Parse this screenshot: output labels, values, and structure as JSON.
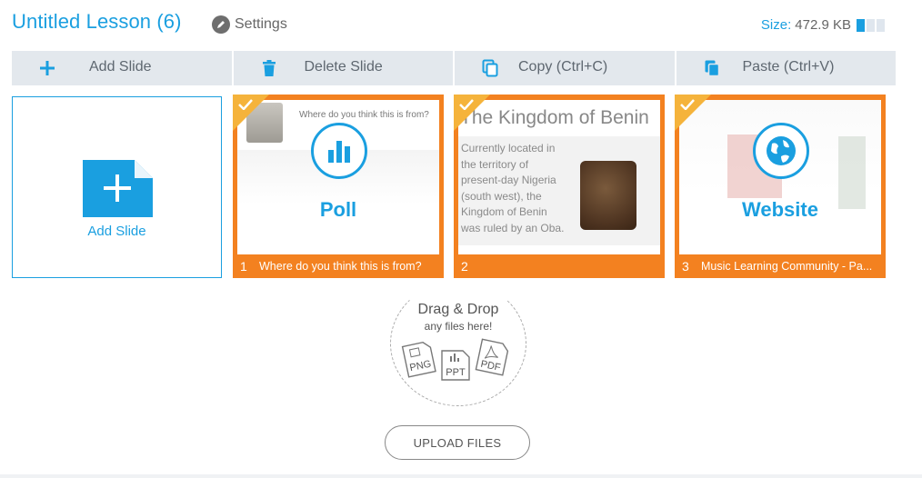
{
  "header": {
    "title": "Untitled Lesson (6)",
    "settings_label": "Settings",
    "size_label": "Size:",
    "size_value": "472.9 KB"
  },
  "toolbar": {
    "add_label": "Add Slide",
    "delete_label": "Delete Slide",
    "copy_label": "Copy (Ctrl+C)",
    "paste_label": "Paste (Ctrl+V)"
  },
  "add_tile": {
    "label": "Add Slide"
  },
  "slides": [
    {
      "number": "1",
      "title": "Where do you think this is from?",
      "type_label": "Poll",
      "question": "Where do you think this is from?"
    },
    {
      "number": "2",
      "heading": "The Kingdom of Benin",
      "body": "Currently located in the territory of present-day Nigeria (south west), the Kingdom of Benin was ruled by an Oba."
    },
    {
      "number": "3",
      "title": "Music Learning Community - Pa...",
      "type_label": "Website"
    }
  ],
  "dropzone": {
    "title": "Drag & Drop",
    "subtitle": "any files here!",
    "file_types": [
      "PNG",
      "PPT",
      "PDF"
    ]
  },
  "upload_label": "UPLOAD FILES",
  "colors": {
    "accent": "#1a9fe0",
    "card_orange": "#f38120",
    "toolbar_bg": "#e3e8ed"
  }
}
